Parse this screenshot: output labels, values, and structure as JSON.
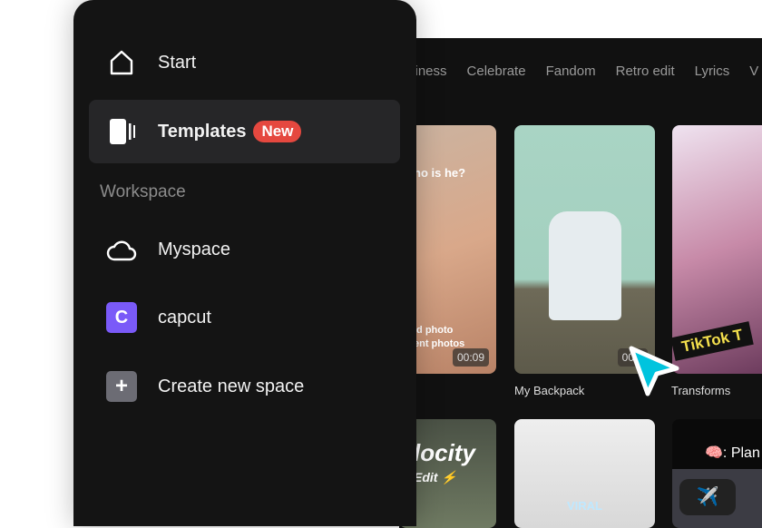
{
  "sidebar": {
    "start": "Start",
    "templates": "Templates",
    "new_badge": "New",
    "section": "Workspace",
    "myspace": "Myspace",
    "capcut": "capcut",
    "capcut_initial": "C",
    "create": "Create new space"
  },
  "tabs": [
    "siness",
    "Celebrate",
    "Fandom",
    "Retro edit",
    "Lyrics",
    "V"
  ],
  "cards": [
    {
      "overlay1": "ho is he?",
      "overlay2": "ld photo",
      "overlay3": "ent photos",
      "duration": "00:09"
    },
    {
      "title": "My Backpack",
      "duration": "00:0"
    },
    {
      "title": "Transforms",
      "overlay1": "TikTok T"
    },
    {
      "overlay1": "locity",
      "overlay2": "Edit ⚡"
    },
    {
      "overlay1": "VIRAL"
    },
    {
      "overlay1": "🧠: Plan",
      "overlay2": "✈️"
    }
  ],
  "colors": {
    "accent": "#e5483f",
    "avatar": "#7a5af8",
    "cursor": "#00c4de"
  }
}
